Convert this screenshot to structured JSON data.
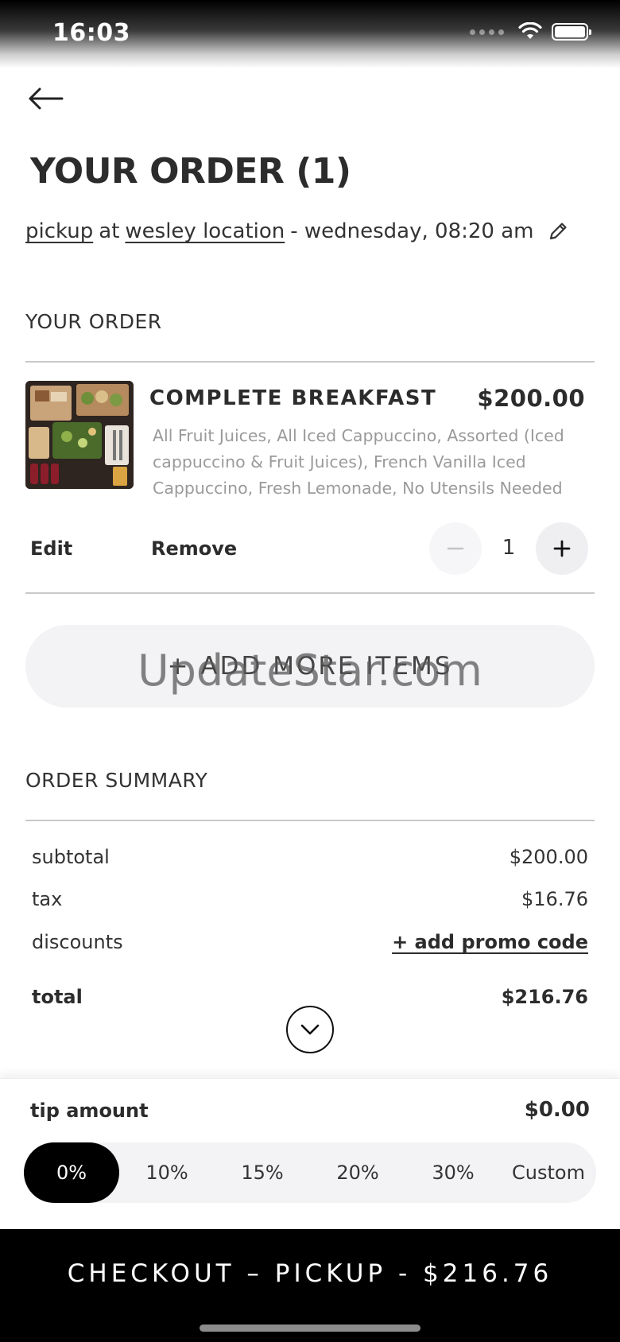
{
  "status_bar": {
    "time": "16:03"
  },
  "header": {
    "title": "YOUR ORDER (1)"
  },
  "pickup": {
    "method": "pickup",
    "connector": "at",
    "location": "wesley location",
    "datetime": "- wednesday, 08:20 am"
  },
  "order_section": {
    "label": "YOUR ORDER",
    "item": {
      "name": "COMPLETE BREAKFAST",
      "price": "$200.00",
      "description": "All Fruit Juices, All Iced Cappuccino, Assorted (Iced cappuccino & Fruit Juices), French Vanilla Iced Cappuccino, Fresh Lemonade, No Utensils Needed",
      "edit_label": "Edit",
      "remove_label": "Remove",
      "quantity": "1",
      "minus_symbol": "−",
      "plus_symbol": "+"
    },
    "add_more_label": "+ ADD MORE ITEMS",
    "watermark": "UpdateStar.com"
  },
  "summary": {
    "label": "ORDER SUMMARY",
    "subtotal_label": "subtotal",
    "subtotal_value": "$200.00",
    "tax_label": "tax",
    "tax_value": "$16.76",
    "discounts_label": "discounts",
    "promo_label": "+ add promo code",
    "total_label": "total",
    "total_value": "$216.76"
  },
  "tip": {
    "label": "tip amount",
    "amount": "$0.00",
    "options": [
      "0%",
      "10%",
      "15%",
      "20%",
      "30%",
      "Custom"
    ],
    "selected": "0%"
  },
  "checkout": {
    "label": "CHECKOUT – PICKUP - $216.76"
  },
  "colors": {
    "accent": "#000000",
    "pill_bg": "#f3f3f6",
    "muted_text": "#9a9a9a"
  },
  "icons": {
    "back": "arrow-left-icon",
    "edit": "pencil-icon",
    "expand": "chevron-down-icon",
    "wifi": "wifi-icon",
    "battery": "battery-icon"
  }
}
